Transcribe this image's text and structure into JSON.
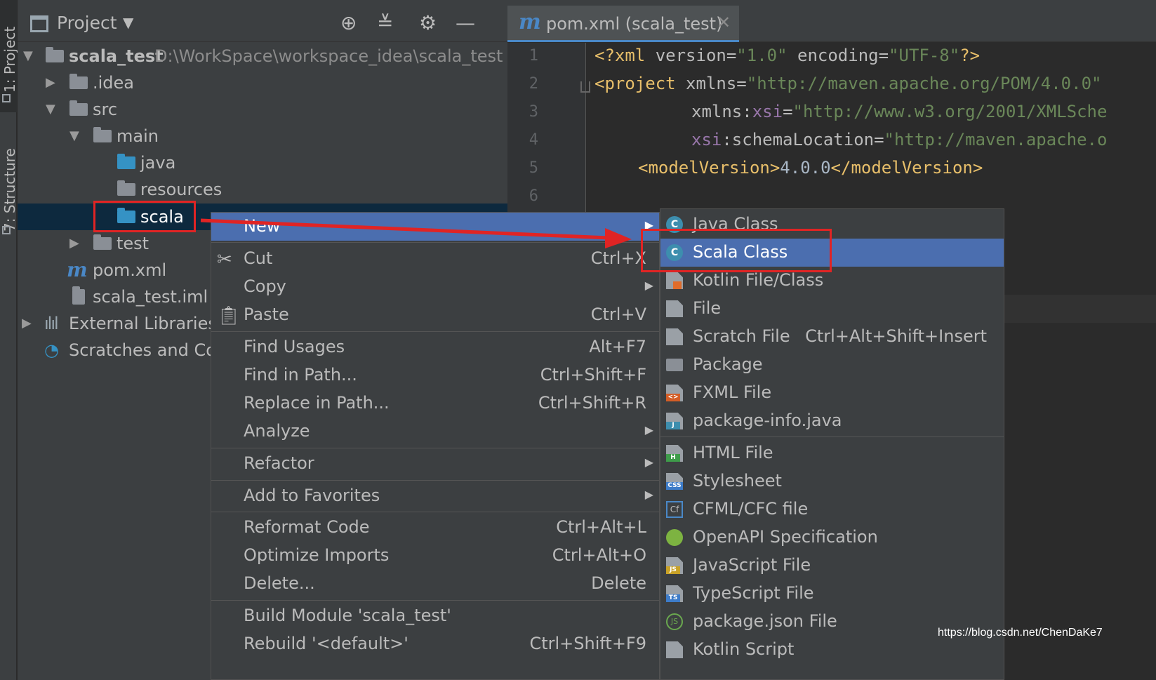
{
  "stripe": {
    "project_label": "1: Project",
    "structure_label": "7: Structure"
  },
  "project_panel": {
    "title": "Project",
    "tree": [
      {
        "label": "scala_test",
        "path": "D:\\WorkSpace\\workspace_idea\\scala_test"
      },
      {
        "label": ".idea"
      },
      {
        "label": "src"
      },
      {
        "label": "main"
      },
      {
        "label": "java"
      },
      {
        "label": "resources"
      },
      {
        "label": "scala"
      },
      {
        "label": "test"
      },
      {
        "label": "pom.xml"
      },
      {
        "label": "scala_test.iml"
      },
      {
        "label": "External Libraries"
      },
      {
        "label": "Scratches and Con"
      }
    ]
  },
  "editor": {
    "tab_title": "pom.xml (scala_test)",
    "tab_icon": "m",
    "line_numbers": [
      "1",
      "2",
      "3",
      "4",
      "5",
      "6"
    ],
    "code": [
      {
        "p1": "<?xml ",
        "p2": "version=",
        "p3": "\"1.0\"",
        "p4": " encoding=",
        "p5": "\"UTF-8\"",
        "p6": "?>"
      },
      {
        "p1": "<project ",
        "p2": "xmlns=",
        "p3": "\"http://maven.apache.org/POM/4.0.0\""
      },
      {
        "p1": "xmlns:",
        "p2": "xsi",
        "p3": "=",
        "p4": "\"http://www.w3.org/2001/XMLSche"
      },
      {
        "p1": "xsi",
        "p2": ":schemaLocation=",
        "p3": "\"http://maven.apache.o"
      },
      {
        "p1": "<modelVersion>",
        "p2": "4.0.0",
        "p3": "</modelVersion>"
      }
    ]
  },
  "context_menu": {
    "items": [
      {
        "label": "New",
        "shortcut": ""
      },
      {
        "label": "Cut",
        "shortcut": "Ctrl+X"
      },
      {
        "label": "Copy",
        "shortcut": ""
      },
      {
        "label": "Paste",
        "shortcut": "Ctrl+V"
      },
      {
        "label": "Find Usages",
        "shortcut": "Alt+F7"
      },
      {
        "label": "Find in Path...",
        "shortcut": "Ctrl+Shift+F"
      },
      {
        "label": "Replace in Path...",
        "shortcut": "Ctrl+Shift+R"
      },
      {
        "label": "Analyze",
        "shortcut": ""
      },
      {
        "label": "Refactor",
        "shortcut": ""
      },
      {
        "label": "Add to Favorites",
        "shortcut": ""
      },
      {
        "label": "Reformat Code",
        "shortcut": "Ctrl+Alt+L"
      },
      {
        "label": "Optimize Imports",
        "shortcut": "Ctrl+Alt+O"
      },
      {
        "label": "Delete...",
        "shortcut": "Delete"
      },
      {
        "label": "Build Module 'scala_test'",
        "shortcut": ""
      },
      {
        "label": "Rebuild '<default>'",
        "shortcut": "Ctrl+Shift+F9"
      }
    ]
  },
  "new_submenu": {
    "items": [
      {
        "label": "Java Class",
        "shortcut": ""
      },
      {
        "label": "Scala Class",
        "shortcut": ""
      },
      {
        "label": "Kotlin File/Class",
        "shortcut": ""
      },
      {
        "label": "File",
        "shortcut": ""
      },
      {
        "label": "Scratch File",
        "shortcut": "Ctrl+Alt+Shift+Insert"
      },
      {
        "label": "Package",
        "shortcut": ""
      },
      {
        "label": "FXML File",
        "shortcut": ""
      },
      {
        "label": "package-info.java",
        "shortcut": ""
      },
      {
        "label": "HTML File",
        "shortcut": ""
      },
      {
        "label": "Stylesheet",
        "shortcut": ""
      },
      {
        "label": "CFML/CFC file",
        "shortcut": ""
      },
      {
        "label": "OpenAPI Specification",
        "shortcut": ""
      },
      {
        "label": "JavaScript File",
        "shortcut": ""
      },
      {
        "label": "TypeScript File",
        "shortcut": ""
      },
      {
        "label": "package.json File",
        "shortcut": ""
      },
      {
        "label": "Kotlin Script",
        "shortcut": ""
      }
    ],
    "icon_tags": {
      "fxml": "<>",
      "java": "J",
      "html": "H",
      "css": "CSS",
      "cf": "Cf",
      "js": "JS",
      "ts": "TS",
      "json": "JS"
    }
  },
  "watermark": "https://blog.csdn.net/ChenDaKe7",
  "colors": {
    "selection": "#4b6eaf",
    "annotation": "#e02424",
    "background": "#2b2b2b"
  }
}
